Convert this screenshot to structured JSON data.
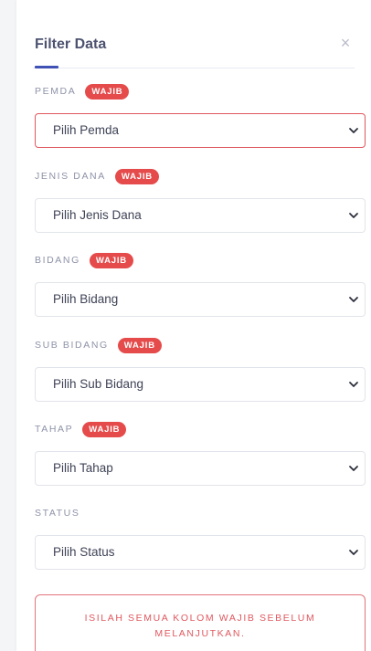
{
  "panel": {
    "title": "Filter Data",
    "close_symbol": "×"
  },
  "fields": [
    {
      "label": "PEMDA",
      "badge": "WAJIB",
      "value": "Pilih Pemda"
    },
    {
      "label": "JENIS DANA",
      "badge": "WAJIB",
      "value": "Pilih Jenis Dana"
    },
    {
      "label": "BIDANG",
      "badge": "WAJIB",
      "value": "Pilih Bidang"
    },
    {
      "label": "SUB BIDANG",
      "badge": "WAJIB",
      "value": "Pilih Sub Bidang"
    },
    {
      "label": "TAHAP",
      "badge": "WAJIB",
      "value": "Pilih Tahap"
    },
    {
      "label": "STATUS",
      "value": "Pilih Status"
    }
  ],
  "alert": {
    "message": "ISILAH SEMUA KOLOM WAJIB SEBELUM MELANJUTKAN."
  },
  "colors": {
    "accent": "#3f51b5",
    "required_badge": "#e54b4b",
    "error": "#e0585f"
  },
  "icons": {
    "close": "close-icon",
    "dropdown": "chevron-down-icon"
  }
}
